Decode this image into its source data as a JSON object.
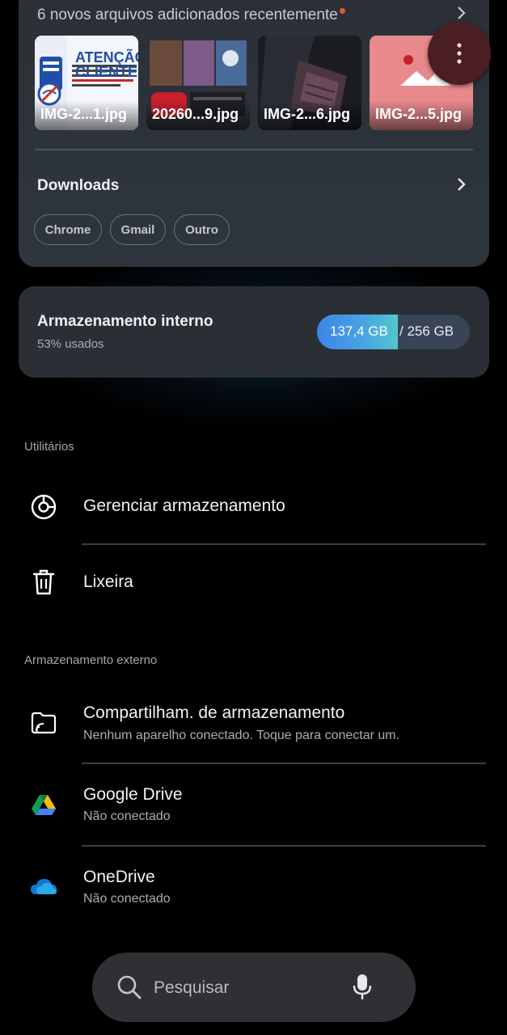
{
  "recent": {
    "header": "6 novos arquivos adicionados recentemente",
    "thumbs": [
      {
        "caption": "IMG-2...1.jpg",
        "text_line1": "ATENÇÃO",
        "text_line2": "CLIENTE"
      },
      {
        "caption": "20260...9.jpg"
      },
      {
        "caption": "IMG-2...6.jpg"
      },
      {
        "caption": "IMG-2...5.jpg"
      }
    ]
  },
  "downloads": {
    "title": "Downloads",
    "chips": [
      "Chrome",
      "Gmail",
      "Outro"
    ]
  },
  "storage": {
    "title": "Armazenamento interno",
    "used_pct_text": "53% usados",
    "used_fraction": 0.53,
    "used": "137,4 GB",
    "total": "/ 256 GB"
  },
  "utilities": {
    "label": "Utilitários",
    "items": [
      {
        "title": "Gerenciar armazenamento",
        "icon": "storage-manager-icon"
      },
      {
        "title": "Lixeira",
        "icon": "trash-icon"
      }
    ]
  },
  "external": {
    "label": "Armazenamento externo",
    "items": [
      {
        "title": "Compartilham. de armazenamento",
        "subtitle": "Nenhum aparelho conectado. Toque para conectar um.",
        "icon": "storage-share-icon"
      },
      {
        "title": "Google Drive",
        "subtitle": "Não conectado",
        "icon": "google-drive-icon"
      },
      {
        "title": "OneDrive",
        "subtitle": "Não conectado",
        "icon": "onedrive-icon"
      }
    ]
  },
  "search": {
    "placeholder": "Pesquisar"
  },
  "colors": {
    "background": "#000000",
    "card": "#2c3138",
    "storage_fill": "#3d84e6",
    "fab": "#4a1e22"
  }
}
